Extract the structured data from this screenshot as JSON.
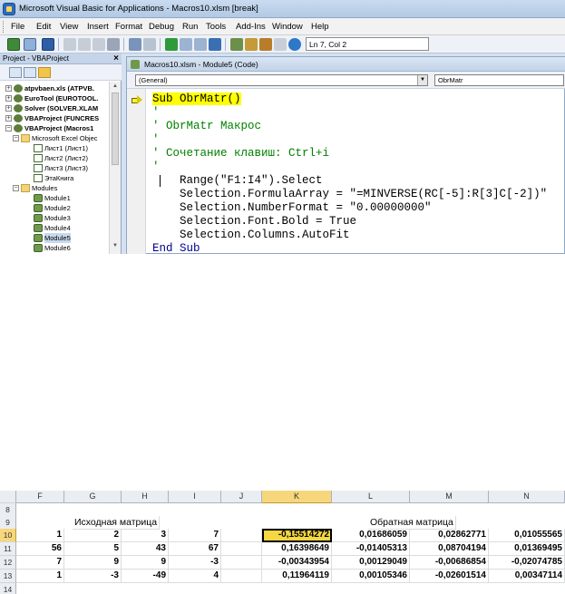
{
  "window": {
    "title": "Microsoft Visual Basic for Applications - Macros10.xlsm [break]"
  },
  "menu": [
    "File",
    "Edit",
    "View",
    "Insert",
    "Format",
    "Debug",
    "Run",
    "Tools",
    "Add-Ins",
    "Window",
    "Help"
  ],
  "toolbar": {
    "status": "Ln 7, Col 2"
  },
  "project": {
    "title": "Project - VBAProject",
    "close": "×",
    "tree": [
      {
        "label": "atpvbaen.xls (ATPVB.",
        "bold": true
      },
      {
        "label": "EuroTool (EUROTOOL.",
        "bold": true
      },
      {
        "label": "Solver (SOLVER.XLAM",
        "bold": true
      },
      {
        "label": "VBAProject (FUNCRES",
        "bold": true
      },
      {
        "label": "VBAProject (Macros1",
        "bold": true
      },
      {
        "label": "Microsoft Excel Objec",
        "bold": false
      },
      {
        "label": "Лист1 (Лист1)",
        "bold": false
      },
      {
        "label": "Лист2 (Лист2)",
        "bold": false
      },
      {
        "label": "Лист3 (Лист3)",
        "bold": false
      },
      {
        "label": "ЭтаКнига",
        "bold": false
      },
      {
        "label": "Modules",
        "bold": false
      },
      {
        "label": "Module1",
        "bold": false
      },
      {
        "label": "Module2",
        "bold": false
      },
      {
        "label": "Module3",
        "bold": false
      },
      {
        "label": "Module4",
        "bold": false
      },
      {
        "label": "Module5",
        "bold": false
      },
      {
        "label": "Module6",
        "bold": false
      }
    ]
  },
  "code_window": {
    "title": "Macros10.xlsm - Module5 (Code)",
    "object_combo": "(General)",
    "proc_combo": "ObrMatr",
    "lines": [
      "Sub ObrMatr()",
      "'",
      "' ObrMatr Макрос",
      "'",
      "' Сочетание клавиш: Ctrl+i",
      "'",
      "    Range(\"F1:I4\").Select",
      "    Selection.FormulaArray = \"=MINVERSE(RC[-5]:R[3]C[-2])\"",
      "    Selection.NumberFormat = \"0.00000000\"",
      "    Selection.Font.Bold = True",
      "    Selection.Columns.AutoFit",
      "End Sub"
    ]
  },
  "excel": {
    "columns": [
      "F",
      "G",
      "H",
      "I",
      "J",
      "K",
      "L",
      "M",
      "N"
    ],
    "rows": [
      "8",
      "9",
      "10",
      "11",
      "12",
      "13",
      "14"
    ],
    "label_source": "Исходная матрица",
    "label_inverse": "Обратная матрица",
    "source": [
      [
        "1",
        "2",
        "3",
        "7"
      ],
      [
        "56",
        "5",
        "43",
        "67"
      ],
      [
        "7",
        "9",
        "9",
        "-3"
      ],
      [
        "1",
        "-3",
        "-49",
        "4"
      ]
    ],
    "inverse": [
      [
        "-0,15514272",
        "0,01686059",
        "0,02862771",
        "0,01055565"
      ],
      [
        "0,16398649",
        "-0,01405313",
        "0,08704194",
        "0,01369495"
      ],
      [
        "-0,00343954",
        "0,00129049",
        "-0,00686854",
        "-0,02074785"
      ],
      [
        "0,11964119",
        "0,00105346",
        "-0,02601514",
        "0,00347114"
      ]
    ]
  }
}
